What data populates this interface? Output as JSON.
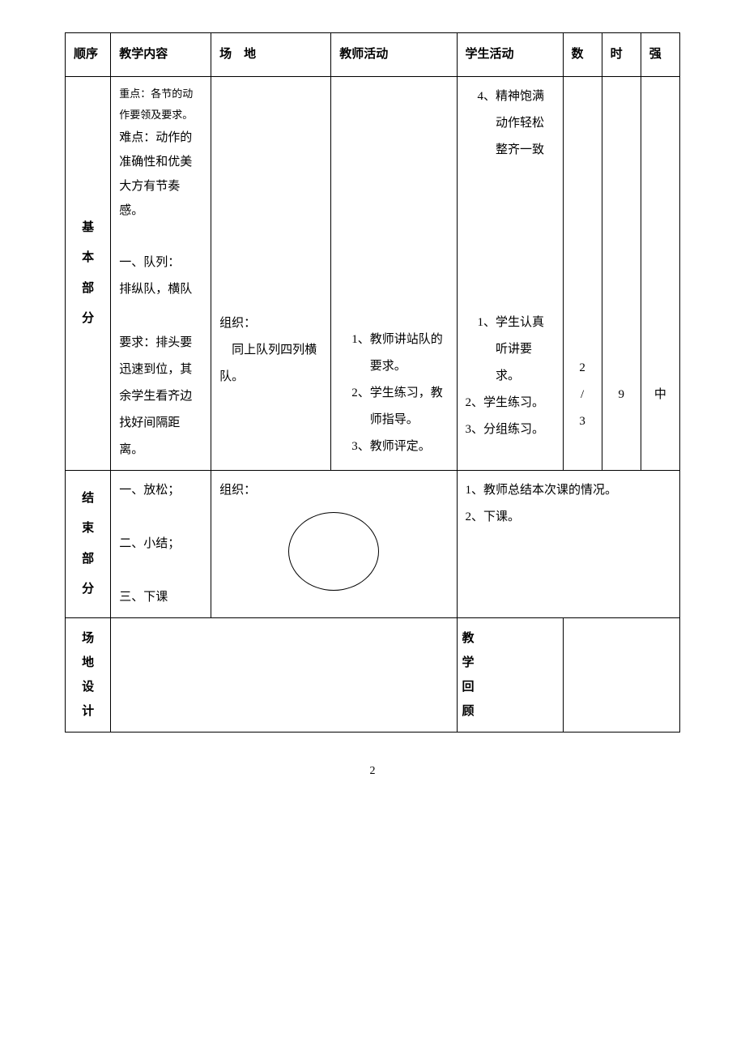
{
  "header": {
    "seq": "顺序",
    "content": "教学内容",
    "venue": "场　地",
    "teacher": "教师活动",
    "student": "学生活动",
    "count": "数",
    "time": "时",
    "intensity": "强"
  },
  "row1": {
    "seq": "基本部分",
    "content_keypoint": "重点：各节的动作要领及要求。",
    "content_difficulty": "难点：动作的准确性和优美大方有节奏感。",
    "content_formation_title": "一、队列：",
    "content_formation_desc": "排纵队，横队",
    "content_requirement": "要求：排头要迅速到位，其余学生看齐边找好间隔距离。",
    "venue_org": "组织：",
    "venue_formation": "　同上队列四列横队。",
    "teacher_1": "1、教师讲站队的要求。",
    "teacher_2": "2、学生练习，教师指导。",
    "teacher_3": "3、教师评定。",
    "student_4": "4、精神饱满动作轻松整齐一致",
    "student_1": "1、学生认真听讲要求。",
    "student_2": "2、学生练习。",
    "student_3": "3、分组练习。",
    "count": "2/3",
    "time": "9",
    "intensity": "中"
  },
  "row2": {
    "seq": "结束部分",
    "content_1": "一、放松；",
    "content_2": "二、小结；",
    "content_3": "三、下课",
    "venue_org": "组织：",
    "activity_1": "1、教师总结本次课的情况。",
    "activity_2": "2、下课。"
  },
  "row3": {
    "label1": "场地设计",
    "label2": "教学回顾"
  },
  "pageNumber": "2"
}
